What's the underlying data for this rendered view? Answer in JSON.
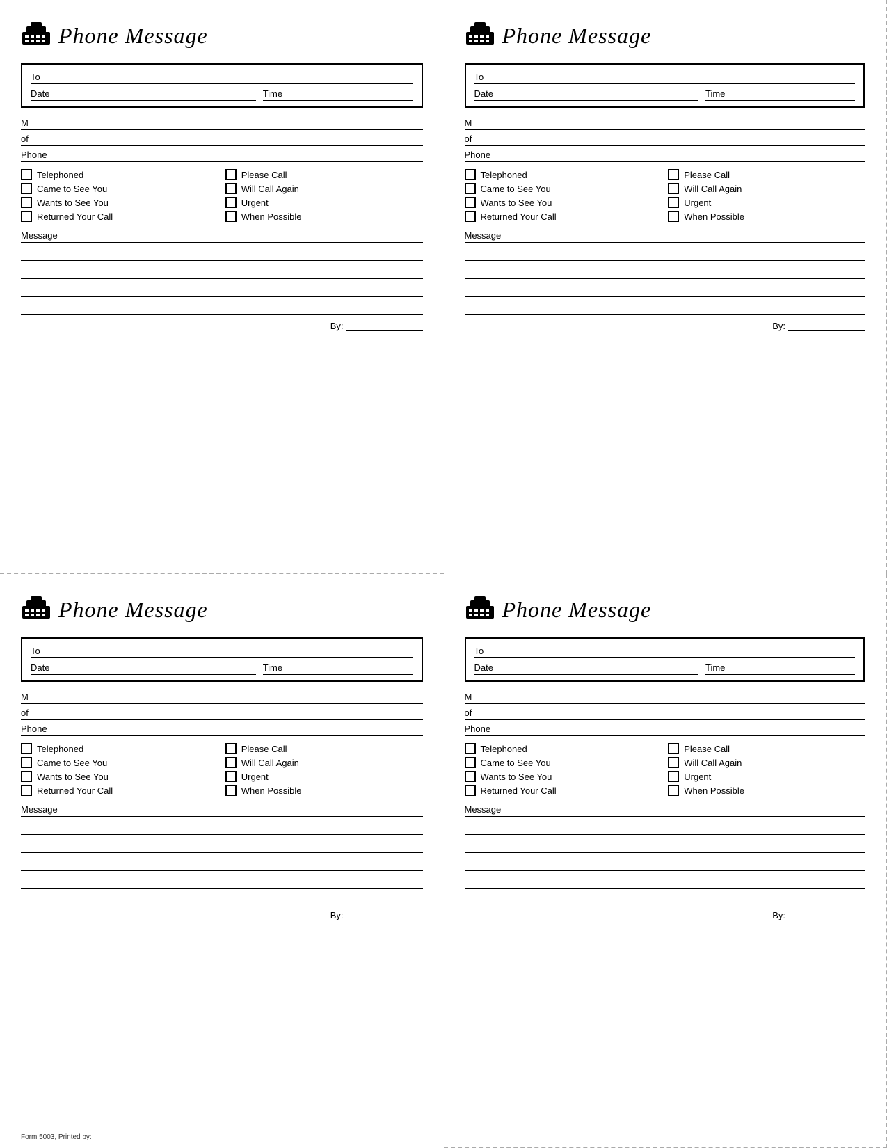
{
  "cards": [
    {
      "id": "card-1",
      "title": "Phone Message",
      "labels": {
        "to": "To",
        "date": "Date",
        "time": "Time",
        "m": "M",
        "of": "of",
        "phone": "Phone",
        "message": "Message",
        "by": "By:"
      },
      "checkboxes": [
        {
          "label": "Telephoned",
          "col": 0
        },
        {
          "label": "Please Call",
          "col": 1
        },
        {
          "label": "Came to See You",
          "col": 0
        },
        {
          "label": "Will Call Again",
          "col": 1
        },
        {
          "label": "Wants to See You",
          "col": 0
        },
        {
          "label": "Urgent",
          "col": 1
        },
        {
          "label": "Returned Your Call",
          "col": 0
        },
        {
          "label": "When Possible",
          "col": 1
        }
      ],
      "footer": ""
    },
    {
      "id": "card-2",
      "title": "Phone Message",
      "labels": {
        "to": "To",
        "date": "Date",
        "time": "Time",
        "m": "M",
        "of": "of",
        "phone": "Phone",
        "message": "Message",
        "by": "By:"
      },
      "checkboxes": [
        {
          "label": "Telephoned",
          "col": 0
        },
        {
          "label": "Please Call",
          "col": 1
        },
        {
          "label": "Came to See You",
          "col": 0
        },
        {
          "label": "Will Call Again",
          "col": 1
        },
        {
          "label": "Wants to See You",
          "col": 0
        },
        {
          "label": "Urgent",
          "col": 1
        },
        {
          "label": "Returned Your Call",
          "col": 0
        },
        {
          "label": "When Possible",
          "col": 1
        }
      ],
      "footer": ""
    },
    {
      "id": "card-3",
      "title": "Phone Message",
      "labels": {
        "to": "To",
        "date": "Date",
        "time": "Time",
        "m": "M",
        "of": "of",
        "phone": "Phone",
        "message": "Message",
        "by": "By:"
      },
      "checkboxes": [
        {
          "label": "Telephoned",
          "col": 0
        },
        {
          "label": "Please Call",
          "col": 1
        },
        {
          "label": "Came to See You",
          "col": 0
        },
        {
          "label": "Will Call Again",
          "col": 1
        },
        {
          "label": "Wants to See You",
          "col": 0
        },
        {
          "label": "Urgent",
          "col": 1
        },
        {
          "label": "Returned Your Call",
          "col": 0
        },
        {
          "label": "When Possible",
          "col": 1
        }
      ],
      "footer": "Form 5003, Printed by:"
    },
    {
      "id": "card-4",
      "title": "Phone Message",
      "labels": {
        "to": "To",
        "date": "Date",
        "time": "Time",
        "m": "M",
        "of": "of",
        "phone": "Phone",
        "message": "Message",
        "by": "By:"
      },
      "checkboxes": [
        {
          "label": "Telephoned",
          "col": 0
        },
        {
          "label": "Please Call",
          "col": 1
        },
        {
          "label": "Came to See You",
          "col": 0
        },
        {
          "label": "Will Call Again",
          "col": 1
        },
        {
          "label": "Wants to See You",
          "col": 0
        },
        {
          "label": "Urgent",
          "col": 1
        },
        {
          "label": "Returned Your Call",
          "col": 0
        },
        {
          "label": "When Possible",
          "col": 1
        }
      ],
      "footer": ""
    }
  ]
}
